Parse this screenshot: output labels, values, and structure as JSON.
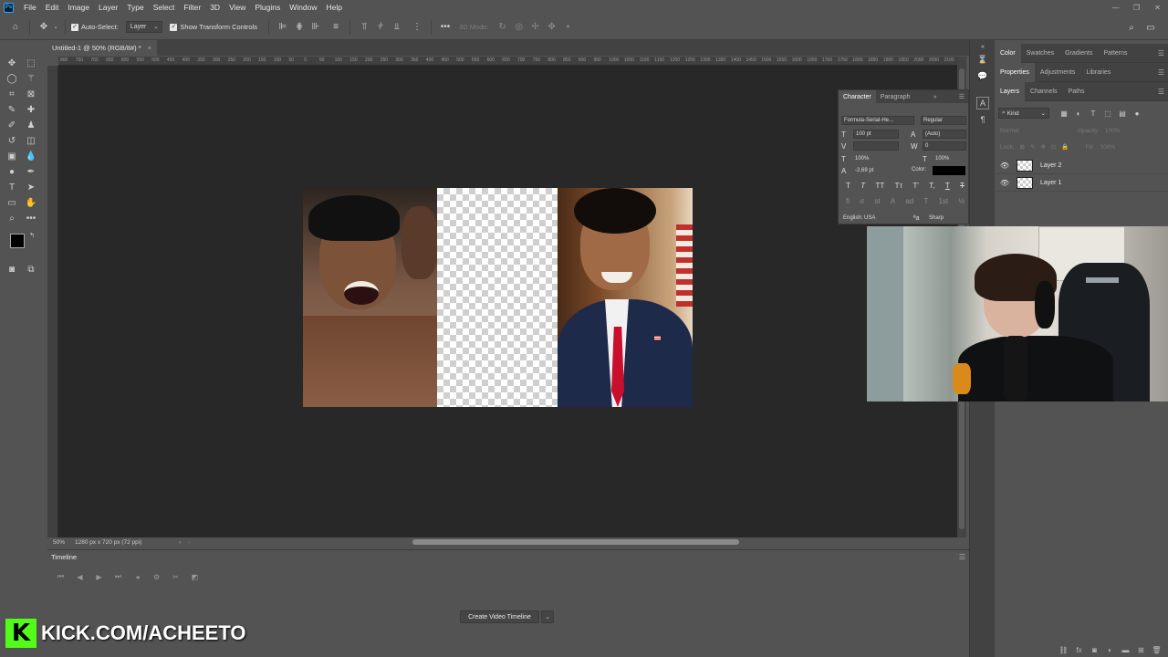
{
  "menu": [
    "File",
    "Edit",
    "Image",
    "Layer",
    "Type",
    "Select",
    "Filter",
    "3D",
    "View",
    "Plugins",
    "Window",
    "Help"
  ],
  "app_logo": "Ps",
  "window_controls": {
    "minimize": "—",
    "restore": "❐",
    "close": "✕"
  },
  "options_bar": {
    "auto_select_label": "Auto-Select:",
    "auto_select_target": "Layer",
    "show_transform_label": "Show Transform Controls",
    "mode_3d_label": "3D Mode:"
  },
  "document_tab": {
    "title": "Untitled-1 @ 50% (RGB/8#) *",
    "close": "×"
  },
  "ruler_top_labels": [
    "800",
    "750",
    "700",
    "650",
    "600",
    "550",
    "500",
    "450",
    "400",
    "350",
    "300",
    "250",
    "200",
    "150",
    "100",
    "50",
    "0",
    "50",
    "100",
    "150",
    "200",
    "250",
    "300",
    "350",
    "400",
    "450",
    "500",
    "550",
    "600",
    "650",
    "700",
    "750",
    "800",
    "850",
    "900",
    "950",
    "1000",
    "1050",
    "1100",
    "1150",
    "1200",
    "1250",
    "1300",
    "1350",
    "1400",
    "1450",
    "1500",
    "1550",
    "1600",
    "1650",
    "1700",
    "1750",
    "1800",
    "1850",
    "1900",
    "1950",
    "2000",
    "2050",
    "2100"
  ],
  "status_bar": {
    "zoom": "50%",
    "doc_info": "1280 px x 720 px (72 ppi)"
  },
  "timeline": {
    "tab_label": "Timeline",
    "create_button": "Create Video Timeline"
  },
  "overlay": {
    "logo_letter": "K",
    "url_text": "KICK.COM/ACHEETO",
    "brand_color": "#53fc18"
  },
  "panels": {
    "color_tabs": [
      "Color",
      "Swatches",
      "Gradients",
      "Patterns"
    ],
    "properties_tabs": [
      "Properties",
      "Adjustments",
      "Libraries"
    ],
    "layers_tabs": [
      "Layers",
      "Channels",
      "Paths"
    ],
    "layers_filter": "Kind",
    "blend_mode": "Normal",
    "opacity_label": "Opacity:",
    "opacity_value": "100%",
    "lock_label": "Lock:",
    "fill_label": "Fill:",
    "fill_value": "100%",
    "layers": [
      {
        "name": "Layer 2"
      },
      {
        "name": "Layer 1"
      }
    ]
  },
  "character_panel": {
    "tabs": [
      "Character",
      "Paragraph"
    ],
    "font_family": "Formula-Serial-He...",
    "font_style": "Regular",
    "font_size": "100 pt",
    "leading": "(Auto)",
    "tracking": "0",
    "vertical_scale": "100%",
    "horizontal_scale": "100%",
    "baseline_shift": "-2,69 pt",
    "color_label": "Color:",
    "language": "English: USA",
    "antialias": "Sharp",
    "text_color": "#000000"
  }
}
